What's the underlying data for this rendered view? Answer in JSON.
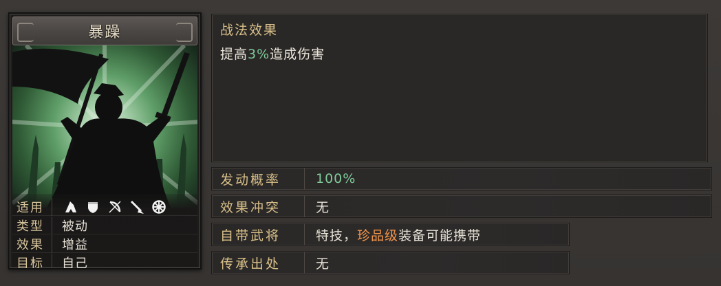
{
  "card": {
    "title": "暴躁",
    "art": "silhouette-warrior-green-burst",
    "stats": [
      {
        "key": "适用",
        "icons": [
          "cavalry-icon",
          "shield-icon",
          "bow-icon",
          "spear-icon",
          "wheel-icon"
        ]
      },
      {
        "key": "类型",
        "value": "被动"
      },
      {
        "key": "效果",
        "value": "增益"
      },
      {
        "key": "目标",
        "value": "自己"
      }
    ]
  },
  "effect": {
    "title": "战法效果",
    "desc_prefix": "提高",
    "desc_highlight": "3%",
    "desc_suffix": "造成伤害",
    "highlight_color": "#7fcb9a"
  },
  "info": [
    {
      "label": "发动概率",
      "value": "100%"
    },
    {
      "label": "效果冲突",
      "value": "无"
    },
    {
      "label": "自带武将",
      "value_prefix": "特技，",
      "value_highlight": "珍品级",
      "value_suffix": "装备可能携带"
    },
    {
      "label": "传承出处",
      "value": "无"
    }
  ],
  "colors": {
    "label_gold": "#d9c089",
    "value_green": "#7fcb9a",
    "rarity_orange": "#f2944a"
  }
}
